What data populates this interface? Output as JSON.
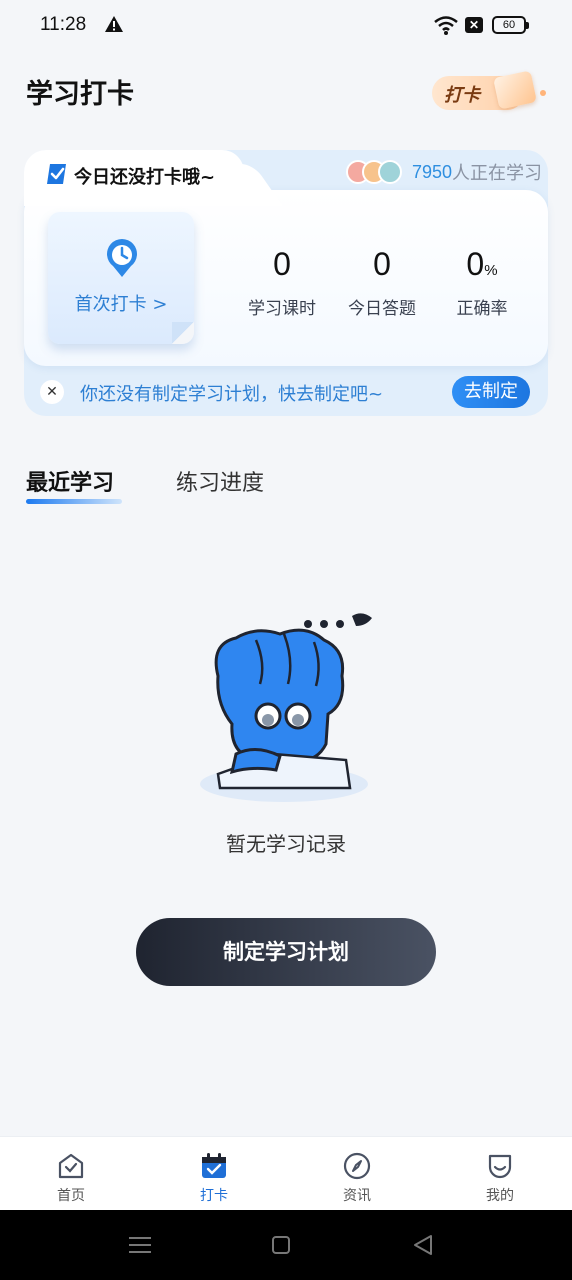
{
  "status_bar": {
    "time": "11:28",
    "battery": "60"
  },
  "header": {
    "title": "学习打卡",
    "badge_label": "打卡"
  },
  "checkin_card": {
    "tab_label": "今日还没打卡哦~",
    "learners_count": "7950",
    "learners_suffix": "人正在学习",
    "first_checkin_label": "首次打卡 >",
    "stats": [
      {
        "value": "0",
        "unit": "",
        "label": "学习课时"
      },
      {
        "value": "0",
        "unit": "",
        "label": "今日答题"
      },
      {
        "value": "0",
        "unit": "%",
        "label": "正确率"
      }
    ],
    "plan_tip": "你还没有制定学习计划，快去制定吧~",
    "plan_button": "去制定"
  },
  "tabs": {
    "recent": "最近学习",
    "progress": "练习进度"
  },
  "empty_state": {
    "text": "暂无学习记录"
  },
  "primary_button": "制定学习计划",
  "bottom_nav": [
    {
      "label": "首页",
      "icon": "home-icon"
    },
    {
      "label": "打卡",
      "icon": "calendar-check-icon",
      "active": true
    },
    {
      "label": "资讯",
      "icon": "compass-icon"
    },
    {
      "label": "我的",
      "icon": "profile-icon"
    }
  ],
  "colors": {
    "accent": "#1f6fd6",
    "primary_button": "#1f2430",
    "link_blue": "#2d7fd3"
  }
}
